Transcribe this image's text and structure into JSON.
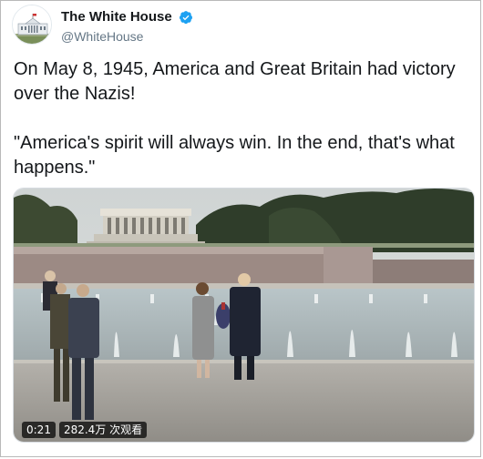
{
  "account": {
    "display_name": "The White House",
    "handle": "@WhiteHouse",
    "verified": true,
    "avatar_icon": "white-house-logo-icon"
  },
  "tweet": {
    "paragraphs": [
      "On May 8, 1945, America and Great Britain had victory over the Nazis!",
      "\"America's spirit will always win. In the end, that's what happens.\""
    ]
  },
  "video": {
    "duration": "0:21",
    "views": "282.4万 次观看"
  },
  "colors": {
    "verified_blue": "#1da1f2",
    "handle_gray": "#657786",
    "text_dark": "#14171a"
  }
}
